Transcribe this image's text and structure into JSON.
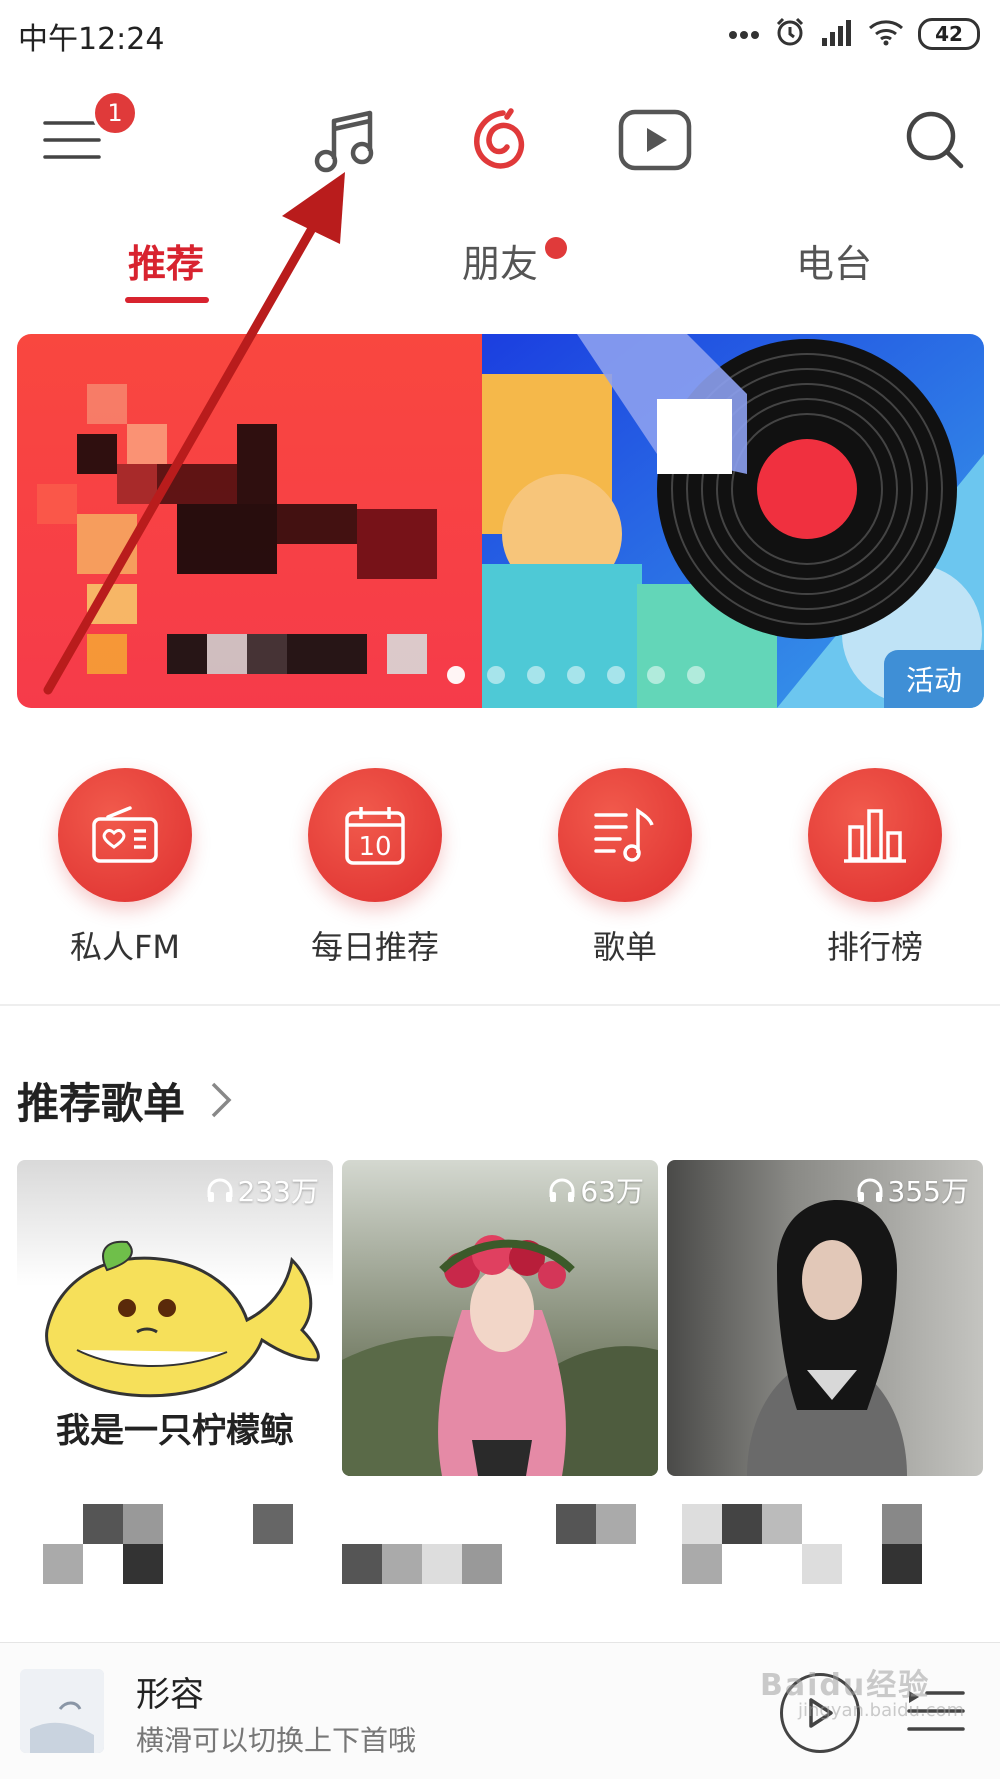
{
  "status_bar": {
    "time": "中午12:24",
    "battery": "42"
  },
  "top_nav": {
    "menu_badge": "1"
  },
  "tabs": [
    {
      "label": "推荐",
      "active": true
    },
    {
      "label": "朋友",
      "has_dot": true
    },
    {
      "label": "电台"
    }
  ],
  "banner": {
    "tag": "活动"
  },
  "entries": [
    {
      "label": "私人FM",
      "icon": "radio-icon"
    },
    {
      "label": "每日推荐",
      "icon": "calendar-icon",
      "icon_text": "10"
    },
    {
      "label": "歌单",
      "icon": "playlist-icon"
    },
    {
      "label": "排行榜",
      "icon": "chart-icon"
    }
  ],
  "section": {
    "title": "推荐歌单"
  },
  "playlists": [
    {
      "play_count": "233万",
      "cover_text": "我是一只柠檬鲸"
    },
    {
      "play_count": "63万"
    },
    {
      "play_count": "355万"
    }
  ],
  "mini_player": {
    "title": "形容",
    "subtitle": "横滑可以切换上下首哦"
  },
  "watermark": {
    "text": "Baidu经验",
    "sub": "jingyan.baidu.com"
  },
  "colors": {
    "accent": "#d8232f",
    "entry": "#e0393a",
    "tag": "#3f8fd6"
  }
}
